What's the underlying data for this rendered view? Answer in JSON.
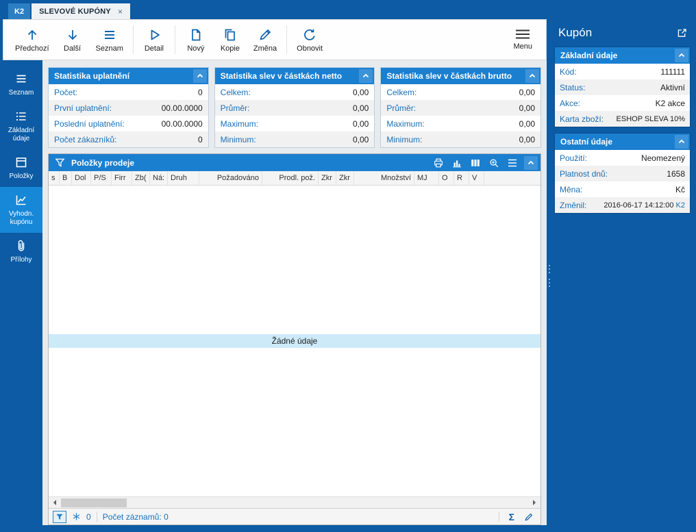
{
  "colors": {
    "frame_blue": "#0c5ba4",
    "panel_header_blue": "#1b7fd0",
    "active_sidebar_blue": "#1787d8",
    "label_blue": "#1a6fb5",
    "empty_band_blue": "#cdeaf9"
  },
  "titlebar": {
    "app_tab": "K2",
    "document_tab": "SLEVOVÉ KUPÓNY",
    "close": "×"
  },
  "toolbar": {
    "buttons": [
      {
        "label": "Předchozí",
        "icon": "arrow-up-icon"
      },
      {
        "label": "Další",
        "icon": "arrow-down-icon"
      },
      {
        "label": "Seznam",
        "icon": "list-icon"
      },
      {
        "label": "Detail",
        "icon": "play-outline-icon"
      },
      {
        "label": "Nový",
        "icon": "new-document-icon"
      },
      {
        "label": "Kopie",
        "icon": "copy-icon"
      },
      {
        "label": "Změna",
        "icon": "pencil-icon"
      },
      {
        "label": "Obnovit",
        "icon": "refresh-icon"
      }
    ],
    "menu": {
      "label": "Menu",
      "icon": "menu-icon"
    }
  },
  "sidebar": {
    "items": [
      {
        "label": "Seznam",
        "icon": "list-icon",
        "active": false
      },
      {
        "label": "Základní údaje",
        "icon": "detail-list-icon",
        "active": false
      },
      {
        "label": "Položky",
        "icon": "items-icon",
        "active": false
      },
      {
        "label": "Vyhodn. kupónu",
        "icon": "chart-icon",
        "active": true
      },
      {
        "label": "Přílohy",
        "icon": "paperclip-icon",
        "active": false
      }
    ]
  },
  "stats": [
    {
      "title": "Statistika uplatnění",
      "rows": [
        {
          "label": "Počet:",
          "value": "0"
        },
        {
          "label": "První uplatnění:",
          "value": "00.00.0000"
        },
        {
          "label": "Poslední uplatnění:",
          "value": "00.00.0000"
        },
        {
          "label": "Počet zákazníků:",
          "value": "0"
        }
      ]
    },
    {
      "title": "Statistika slev v částkách netto",
      "rows": [
        {
          "label": "Celkem:",
          "value": "0,00"
        },
        {
          "label": "Průměr:",
          "value": "0,00"
        },
        {
          "label": "Maximum:",
          "value": "0,00"
        },
        {
          "label": "Minimum:",
          "value": "0,00"
        }
      ]
    },
    {
      "title": "Statistika slev v částkách brutto",
      "rows": [
        {
          "label": "Celkem:",
          "value": "0,00"
        },
        {
          "label": "Průměr:",
          "value": "0,00"
        },
        {
          "label": "Maximum:",
          "value": "0,00"
        },
        {
          "label": "Minimum:",
          "value": "0,00"
        }
      ]
    }
  ],
  "grid": {
    "title": "Položky prodeje",
    "columns": [
      "s",
      "B",
      "Dol",
      "P/S",
      "Firr",
      "Zb(",
      "Ná:",
      "Druh",
      "Požadováno",
      "Prodl. pož.",
      "Zkr",
      "Zkr",
      "Množství",
      "MJ",
      "O",
      "R",
      "V"
    ],
    "empty_message": "Žádné údaje",
    "status": {
      "frozen_count": "0",
      "records": "Počet záznamů: 0",
      "sum_symbol": "Σ"
    }
  },
  "right_panel": {
    "title": "Kupón",
    "sections": [
      {
        "title": "Základní údaje",
        "rows": [
          {
            "label": "Kód:",
            "value": "111111"
          },
          {
            "label": "Status:",
            "value": "Aktivní"
          },
          {
            "label": "Akce:",
            "value": "K2 akce"
          },
          {
            "label": "Karta zboží:",
            "value": "ESHOP SLEVA 10%"
          }
        ]
      },
      {
        "title": "Ostatní údaje",
        "rows": [
          {
            "label": "Použití:",
            "value": "Neomezený"
          },
          {
            "label": "Platnost dnů:",
            "value": "1658"
          },
          {
            "label": "Měna:",
            "value": "Kč"
          },
          {
            "label": "Změnil:",
            "value": "2016-06-17 14:12:00",
            "link": "K2"
          }
        ]
      }
    ]
  }
}
